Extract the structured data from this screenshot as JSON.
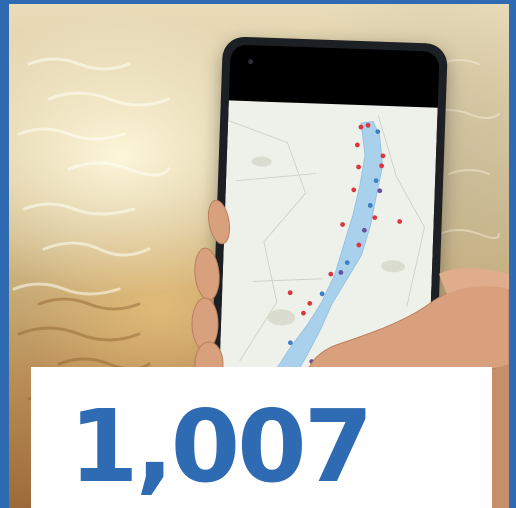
{
  "stat": {
    "value": "1,007"
  },
  "colors": {
    "brand_blue": "#2f6bb3",
    "card_background": "#ffffff",
    "lake_water": "#a9d1ec",
    "marker_red": "#d9363e",
    "marker_blue": "#3b7fc4",
    "marker_purple": "#6b4fa0"
  },
  "icons": {
    "phone": "smartphone-icon",
    "markers": "map-marker-icon"
  }
}
